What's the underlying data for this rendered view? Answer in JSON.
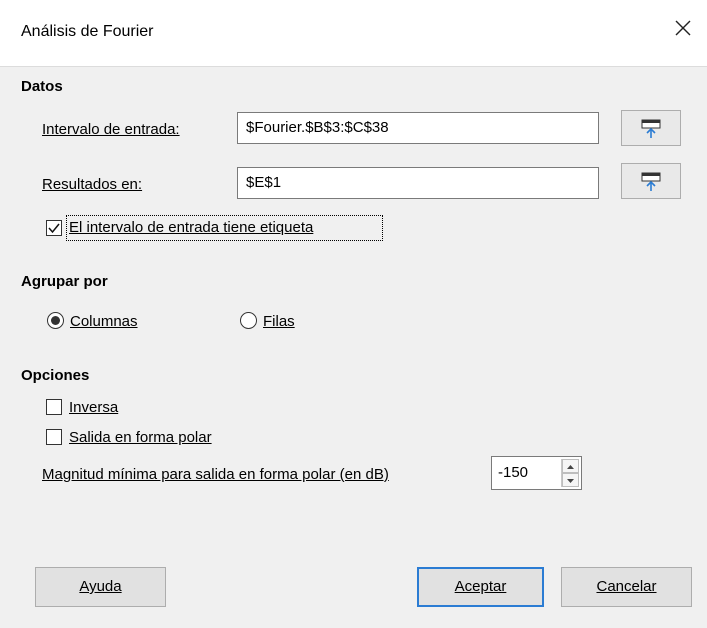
{
  "window": {
    "title": "Análisis de Fourier"
  },
  "datos": {
    "heading": "Datos",
    "input_range_label": "Intervalo de entrada:",
    "input_range_value": "$Fourier.$B$3:$C$38",
    "results_label": "Resultados en:",
    "results_value": "$E$1",
    "has_label_checkbox": {
      "label": "El intervalo de entrada tiene etiqueta",
      "checked": true
    }
  },
  "agrupar": {
    "heading": "Agrupar por",
    "options": [
      {
        "label": "Columnas",
        "selected": true
      },
      {
        "label": "Filas",
        "selected": false
      }
    ]
  },
  "opciones": {
    "heading": "Opciones",
    "inverse": {
      "label": "Inversa",
      "checked": false
    },
    "polar": {
      "label": "Salida en forma polar",
      "checked": false
    },
    "min_magnitude_label": "Magnitud mínima para salida en forma polar (en dB)",
    "min_magnitude_value": "-150"
  },
  "buttons": {
    "help": "Ayuda",
    "ok": "Aceptar",
    "cancel": "Cancelar"
  },
  "colors": {
    "accent": "#2b7cd3",
    "background": "#f0f0f0"
  }
}
